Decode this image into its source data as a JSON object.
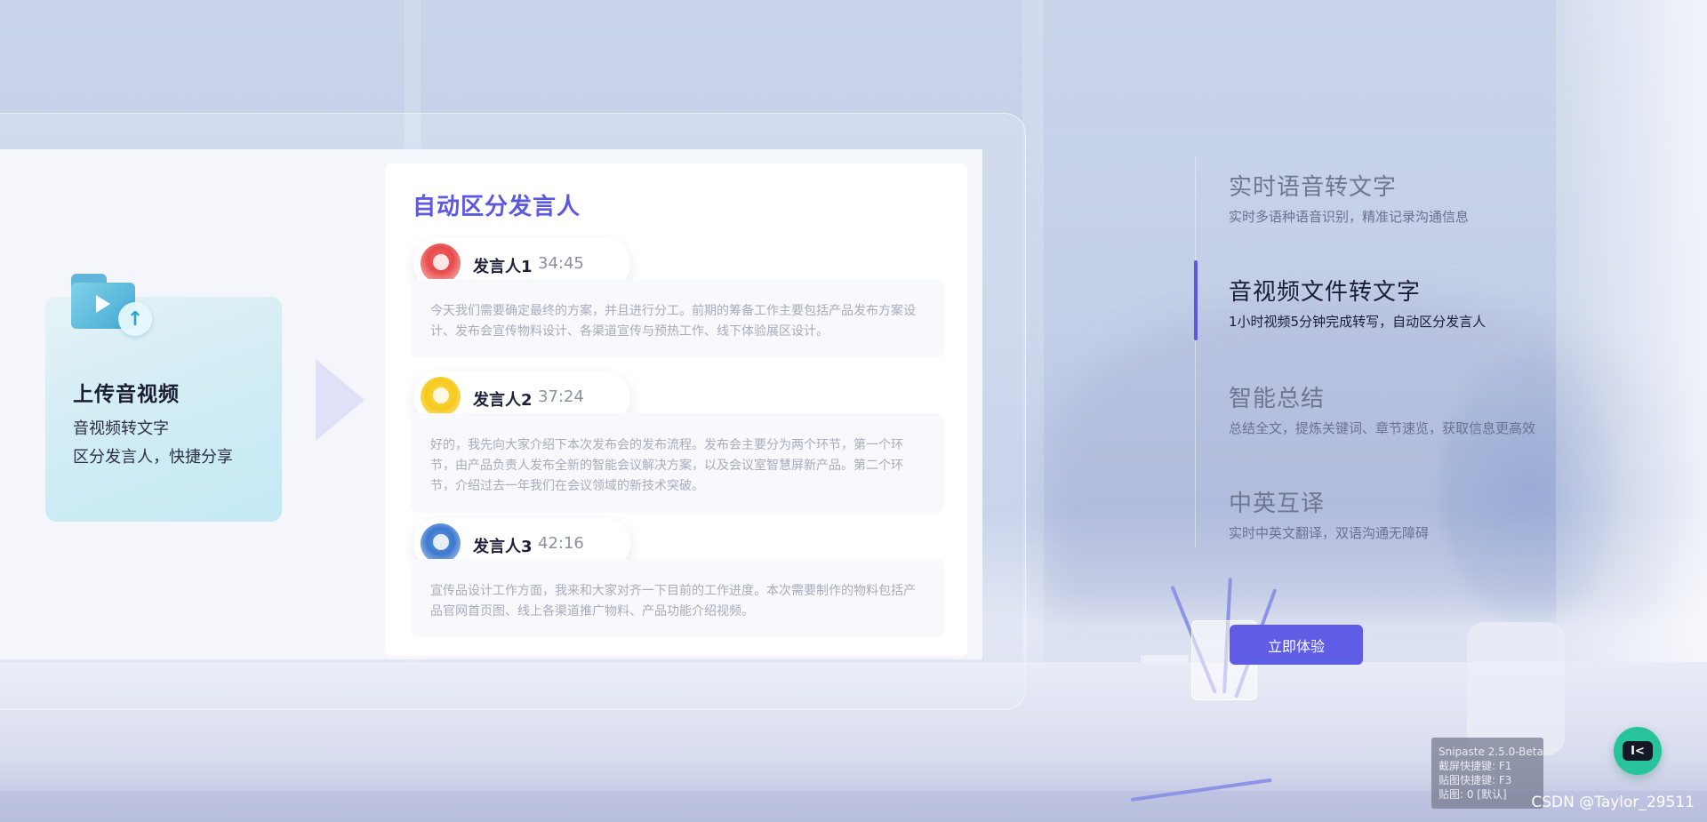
{
  "upload": {
    "title": "上传音视频",
    "line1": "音视频转文字",
    "line2": "区分发言人，快捷分享",
    "folder_icon": "folder-video-icon",
    "upload_icon": "upload-arrow-icon"
  },
  "panel": {
    "title": "自动区分发言人",
    "speakers": [
      {
        "name": "发言人1",
        "time": "34:45",
        "avatar": "parrot-avatar-icon",
        "text": "今天我们需要确定最终的方案，并且进行分工。前期的筹备工作主要包括产品发布方案设计、发布会宣传物料设计、各渠道宣传与预热工作、线下体验展区设计。"
      },
      {
        "name": "发言人2",
        "time": "37:24",
        "avatar": "toucan-avatar-icon",
        "text": "好的，我先向大家介绍下本次发布会的发布流程。发布会主要分为两个环节，第一个环节，由产品负责人发布全新的智能会议解决方案，以及会议室智慧屏新产品。第二个环节，介绍过去一年我们在会议领域的新技术突破。"
      },
      {
        "name": "发言人3",
        "time": "42:16",
        "avatar": "bird-avatar-icon",
        "text": "宣传品设计工作方面，我来和大家对齐一下目前的工作进度。本次需要制作的物料包括产品官网首页图、线上各渠道推广物料、产品功能介绍视频。"
      }
    ]
  },
  "features": [
    {
      "title": "实时语音转文字",
      "desc": "实时多语种语音识别，精准记录沟通信息",
      "active": false
    },
    {
      "title": "音视频文件转文字",
      "desc": "1小时视频5分钟完成转写，自动区分发言人",
      "active": true
    },
    {
      "title": "智能总结",
      "desc": "总结全文，提炼关键词、章节速览，获取信息更高效",
      "active": false
    },
    {
      "title": "中英互译",
      "desc": "实时中英文翻译，双语沟通无障碍",
      "active": false
    }
  ],
  "cta": {
    "label": "立即体验"
  },
  "snipaste": {
    "line1": "Snipaste 2.5.0-Beta",
    "line2": "截屏快捷键: F1",
    "line3": "贴图快捷键: F3",
    "line4": "贴图: 0 [默认]"
  },
  "watermark": "CSDN @Taylor_29511",
  "colors": {
    "accent": "#5d58e0",
    "button": "#5f5ce5",
    "bot": "#27c49b"
  }
}
